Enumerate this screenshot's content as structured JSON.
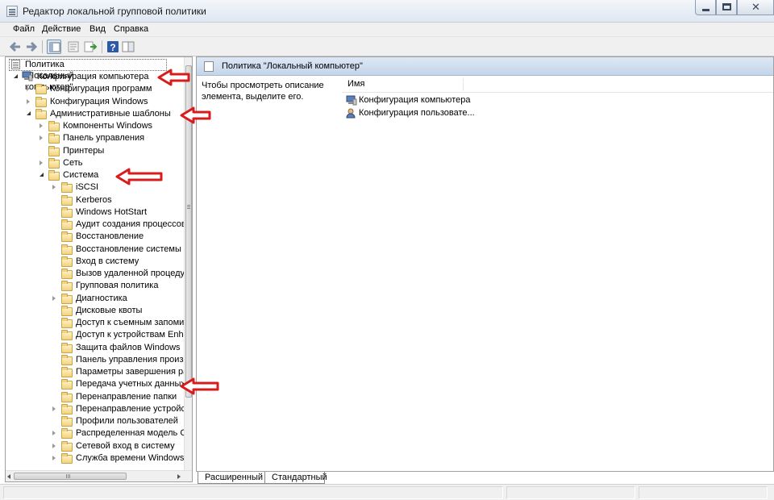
{
  "window": {
    "title": "Редактор локальной групповой политики"
  },
  "menu": [
    "Файл",
    "Действие",
    "Вид",
    "Справка"
  ],
  "toolbar": {
    "icons": [
      "back-arrow-icon",
      "forward-arrow-icon",
      "show-hide-tree-icon",
      "properties-icon",
      "export-list-icon",
      "help-icon",
      "extended-view-icon"
    ]
  },
  "tree": {
    "root": "Политика \"Локальный компьютер\"",
    "items": [
      {
        "label": "Конфигурация компьютера",
        "state": "expanded",
        "icon": "computer-icon"
      },
      {
        "label": "Конфигурация программ",
        "state": "collapsed",
        "icon": "folder-icon"
      },
      {
        "label": "Конфигурация Windows",
        "state": "collapsed",
        "icon": "folder-icon"
      },
      {
        "label": "Административные шаблоны",
        "state": "expanded",
        "icon": "folder-icon"
      },
      {
        "label": "Компоненты Windows",
        "state": "collapsed",
        "icon": "folder-icon"
      },
      {
        "label": "Панель управления",
        "state": "collapsed",
        "icon": "folder-icon"
      },
      {
        "label": "Принтеры",
        "state": "none",
        "icon": "folder-icon"
      },
      {
        "label": "Сеть",
        "state": "collapsed",
        "icon": "folder-icon"
      },
      {
        "label": "Система",
        "state": "expanded",
        "icon": "folder-icon"
      },
      {
        "label": "iSCSI",
        "state": "collapsed",
        "icon": "folder-icon"
      },
      {
        "label": "Kerberos",
        "state": "none",
        "icon": "folder-icon"
      },
      {
        "label": "Windows HotStart",
        "state": "none",
        "icon": "folder-icon"
      },
      {
        "label": "Аудит создания процессов",
        "state": "none",
        "icon": "folder-icon"
      },
      {
        "label": "Восстановление",
        "state": "none",
        "icon": "folder-icon"
      },
      {
        "label": "Восстановление системы",
        "state": "none",
        "icon": "folder-icon"
      },
      {
        "label": "Вход в систему",
        "state": "none",
        "icon": "folder-icon"
      },
      {
        "label": "Вызов удаленной процедуры",
        "state": "none",
        "icon": "folder-icon"
      },
      {
        "label": "Групповая политика",
        "state": "none",
        "icon": "folder-icon"
      },
      {
        "label": "Диагностика",
        "state": "collapsed",
        "icon": "folder-icon"
      },
      {
        "label": "Дисковые квоты",
        "state": "none",
        "icon": "folder-icon"
      },
      {
        "label": "Доступ к съемным запоминающим",
        "state": "none",
        "icon": "folder-icon"
      },
      {
        "label": "Доступ к устройствам Enhanced",
        "state": "none",
        "icon": "folder-icon"
      },
      {
        "label": "Защита файлов Windows",
        "state": "none",
        "icon": "folder-icon"
      },
      {
        "label": "Панель управления производительностью",
        "state": "none",
        "icon": "folder-icon"
      },
      {
        "label": "Параметры завершения работы",
        "state": "none",
        "icon": "folder-icon"
      },
      {
        "label": "Передача учетных данных",
        "state": "none",
        "icon": "folder-icon"
      },
      {
        "label": "Перенаправление папки",
        "state": "none",
        "icon": "folder-icon"
      },
      {
        "label": "Перенаправление устройств",
        "state": "collapsed",
        "icon": "folder-icon"
      },
      {
        "label": "Профили пользователей",
        "state": "none",
        "icon": "folder-icon"
      },
      {
        "label": "Распределенная модель COM",
        "state": "collapsed",
        "icon": "folder-icon"
      },
      {
        "label": "Сетевой вход в систему",
        "state": "collapsed",
        "icon": "folder-icon"
      },
      {
        "label": "Служба времени Windows",
        "state": "collapsed",
        "icon": "folder-icon"
      }
    ]
  },
  "details": {
    "header_title": "Политика \"Локальный компьютер\"",
    "description": "Чтобы просмотреть описание элемента, выделите его.",
    "column_name": "Имя",
    "items": [
      {
        "label": "Конфигурация компьютера",
        "icon": "computer-icon"
      },
      {
        "label": "Конфигурация пользовате...",
        "icon": "user-icon"
      }
    ]
  },
  "tabs": [
    "Расширенный",
    "Стандартный"
  ],
  "colors": {
    "annotation_arrow": "#d81c1c",
    "folder": "#f2d27e",
    "header_gradient": "#c4d5ea"
  }
}
